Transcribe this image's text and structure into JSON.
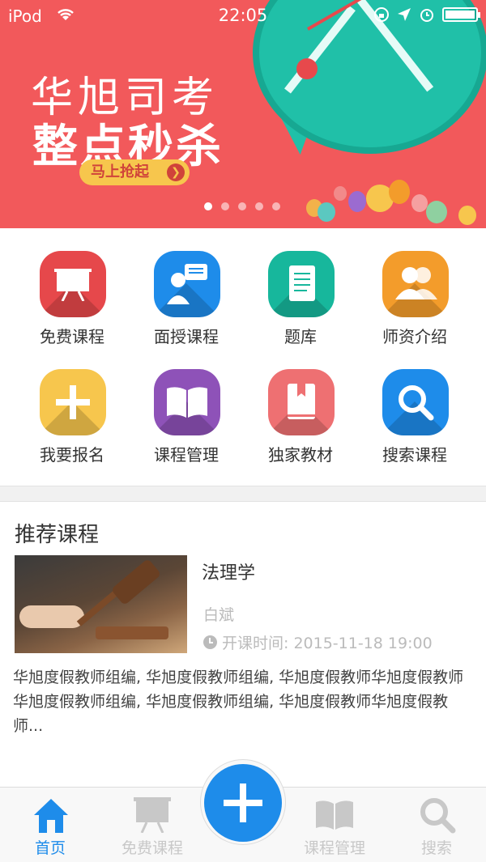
{
  "status_bar": {
    "carrier": "iPod",
    "time": "22:05"
  },
  "banner": {
    "title": "华旭司考",
    "subtitle": "整点秒杀",
    "cta_label": "马上抢起",
    "page_count": 5,
    "active_page": 1,
    "colors": {
      "background": "#f2595b",
      "clock": "#20c0a8",
      "cta": "#f7c64d"
    }
  },
  "grid": {
    "items": [
      {
        "label": "免费课程",
        "icon": "presentation-board-icon",
        "color": "#e6484b"
      },
      {
        "label": "面授课程",
        "icon": "teacher-speech-icon",
        "color": "#1e8cea"
      },
      {
        "label": "题库",
        "icon": "scroll-document-icon",
        "color": "#17b79c"
      },
      {
        "label": "师资介绍",
        "icon": "people-icon",
        "color": "#f39c2b"
      },
      {
        "label": "我要报名",
        "icon": "plus-icon",
        "color": "#f7c64d"
      },
      {
        "label": "课程管理",
        "icon": "open-book-icon",
        "color": "#8e52b8"
      },
      {
        "label": "独家教材",
        "icon": "bookmarked-book-icon",
        "color": "#ee7072"
      },
      {
        "label": "搜索课程",
        "icon": "search-icon",
        "color": "#1e8cea"
      }
    ]
  },
  "recommended": {
    "section_title": "推荐课程",
    "course": {
      "title": "法理学",
      "teacher": "白斌",
      "time_label": "开课时间: 2015-11-18  19:00",
      "description": "华旭度假教师组编, 华旭度假教师组编, 华旭度假教师华旭度假教师华旭度假教师组编, 华旭度假教师组编, 华旭度假教师华旭度假教师..."
    }
  },
  "tabbar": {
    "tabs": [
      {
        "label": "首页",
        "icon": "home-icon",
        "active": true
      },
      {
        "label": "免费课程",
        "icon": "presentation-board-icon",
        "active": false
      },
      {
        "label": "课程管理",
        "icon": "open-book-icon",
        "active": false
      },
      {
        "label": "搜索",
        "icon": "search-icon",
        "active": false
      }
    ],
    "center_button_icon": "plus-icon",
    "colors": {
      "active": "#1e8cea",
      "inactive": "#c8c8c8"
    }
  }
}
